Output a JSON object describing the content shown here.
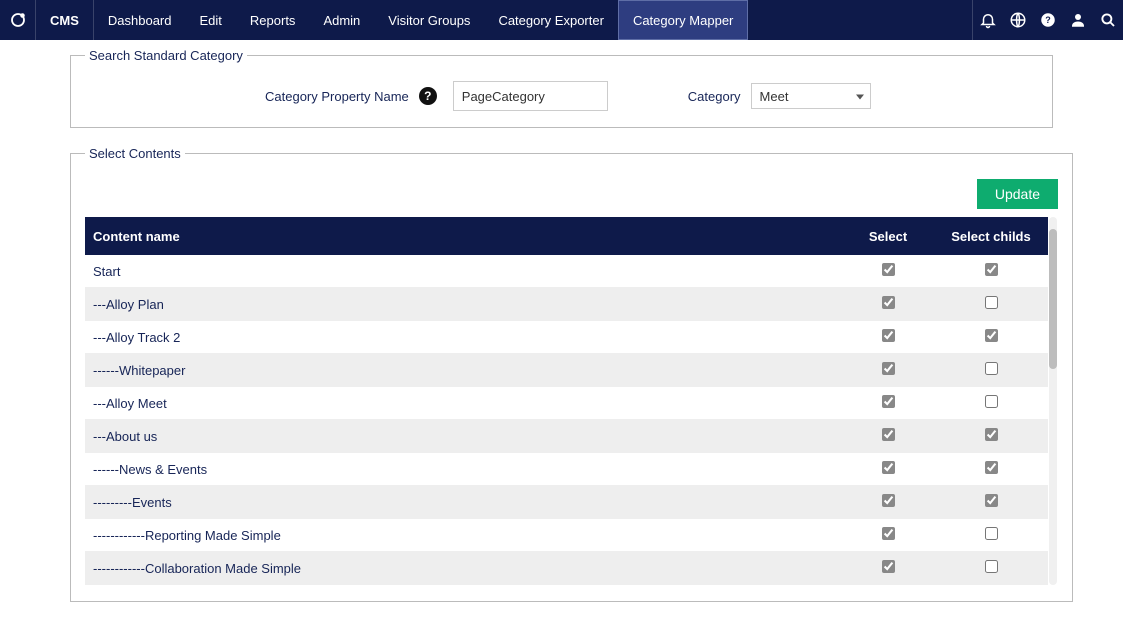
{
  "nav": {
    "brand": "CMS",
    "items": [
      {
        "label": "Dashboard",
        "active": false
      },
      {
        "label": "Edit",
        "active": false
      },
      {
        "label": "Reports",
        "active": false
      },
      {
        "label": "Admin",
        "active": false
      },
      {
        "label": "Visitor Groups",
        "active": false
      },
      {
        "label": "Category Exporter",
        "active": false
      },
      {
        "label": "Category Mapper",
        "active": true
      }
    ]
  },
  "search": {
    "legend": "Search Standard Category",
    "property_label": "Category Property Name",
    "property_value": "PageCategory",
    "category_label": "Category",
    "category_selected": "Meet"
  },
  "contents": {
    "legend": "Select Contents",
    "update_label": "Update",
    "columns": {
      "name": "Content name",
      "select": "Select",
      "childs": "Select childs"
    },
    "rows": [
      {
        "name": "Start",
        "select": true,
        "childs": true
      },
      {
        "name": "---Alloy Plan",
        "select": true,
        "childs": false
      },
      {
        "name": "---Alloy Track 2",
        "select": true,
        "childs": true
      },
      {
        "name": "------Whitepaper",
        "select": true,
        "childs": false
      },
      {
        "name": "---Alloy Meet",
        "select": true,
        "childs": false
      },
      {
        "name": "---About us",
        "select": true,
        "childs": true
      },
      {
        "name": "------News & Events",
        "select": true,
        "childs": true
      },
      {
        "name": "---------Events",
        "select": true,
        "childs": true
      },
      {
        "name": "------------Reporting Made Simple",
        "select": true,
        "childs": false
      },
      {
        "name": "------------Collaboration Made Simple",
        "select": true,
        "childs": false
      }
    ]
  }
}
